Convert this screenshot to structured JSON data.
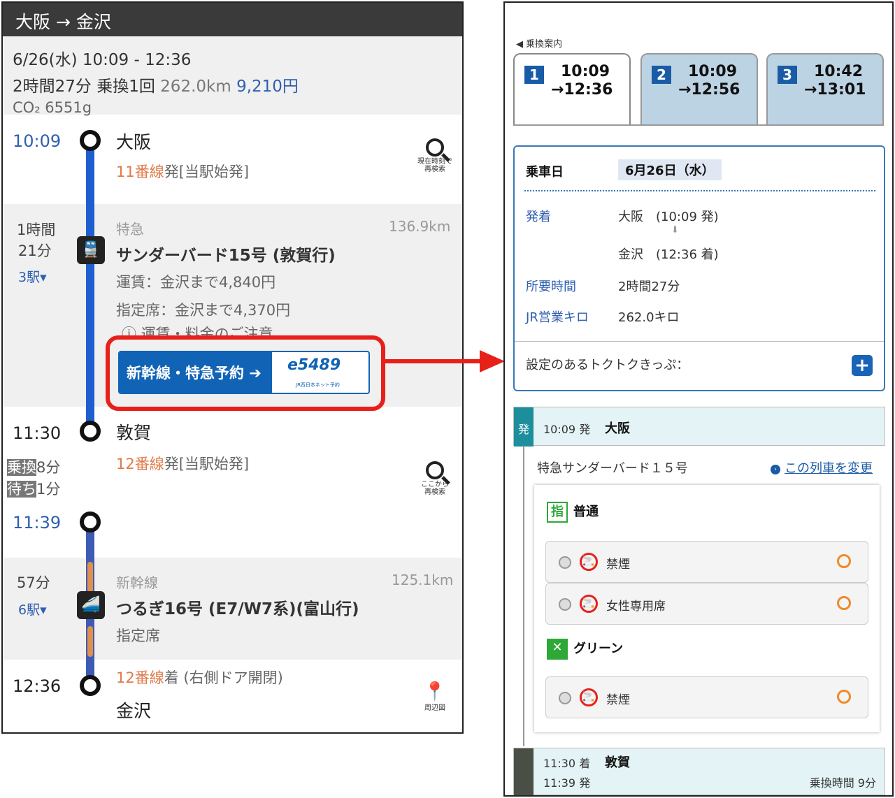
{
  "left": {
    "header": "大阪 → 金沢",
    "summary": {
      "datetime": "6/26(水) 10:09 - 12:36",
      "duration_transfers": "2時間27分 乗換1回",
      "distance": "262.0km",
      "fare": "9,210円",
      "co2": "CO₂ 6551g"
    },
    "stop1": {
      "time": "10:09",
      "station": "大阪",
      "platform_num": "11番線",
      "platform_rest": "発[当駅始発]",
      "search_label_1": "現在時刻で",
      "search_label_2": "再検索"
    },
    "leg1": {
      "duration_1": "1時間",
      "duration_2": "21分",
      "stops": "3駅▾",
      "type": "特急",
      "distance": "136.9km",
      "train": "サンダーバード15号 (敦賀行)",
      "fare": "運賃：金沢まで4,840円",
      "reserved": "指定席：金沢まで4,370円",
      "notice": "ⓘ 運賃・料金のご注意",
      "icon": "train-icon"
    },
    "booking_button": {
      "label": "新幹線・特急予約 ➔",
      "logo": "e5489",
      "logo_sub": "JR西日本ネット予約"
    },
    "stop2": {
      "time": "11:30",
      "station": "敦賀",
      "platform_num": "12番線",
      "platform_rest": "発[当駅始発]",
      "transfer_label": "乗換",
      "transfer_min": "8分",
      "wait_label": "待ち",
      "wait_min": "1分",
      "search_label_1": "ここから",
      "search_label_2": "再検索"
    },
    "stop3": {
      "time": "11:39"
    },
    "leg2": {
      "duration": "57分",
      "stops": "6駅▾",
      "type": "新幹線",
      "distance": "125.1km",
      "train": "つるぎ16号 (E7/W7系)(富山行)",
      "seat": "指定席",
      "icon": "shinkansen-icon"
    },
    "stop4": {
      "time": "12:36",
      "platform_num": "12番線",
      "platform_rest": "着 (右側ドア開閉)",
      "station": "金沢",
      "map_label": "周辺図"
    },
    "colors": {
      "line_blue": "#1e5fcf",
      "accent_orange": "#e07a4a",
      "highlight_red": "#e8201a"
    }
  },
  "right": {
    "back_link": "◀ 乗換案内",
    "tabs": [
      {
        "num": "1",
        "dep": "10:09",
        "arr": "→12:36"
      },
      {
        "num": "2",
        "dep": "10:09",
        "arr": "→12:56"
      },
      {
        "num": "3",
        "dep": "10:42",
        "arr": "→13:01"
      }
    ],
    "info": {
      "date_label": "乗車日",
      "date_value": "6月26日（水）",
      "depart_label": "発着",
      "depart_value": "大阪　(10:09 発)",
      "arrow": "⬇",
      "arrive_value": "金沢　(12:36 着)",
      "duration_label": "所要時間",
      "duration_value": "2時間27分",
      "km_label": "JR営業キロ",
      "km_value": "262.0キロ",
      "discount_label": "設定のあるトクトクきっぷ：",
      "plus": "+"
    },
    "departure": {
      "tag": "発",
      "time": "10:09 発",
      "station": "大阪"
    },
    "train_name": "特急サンダーバード１５号",
    "change_link": "この列車を変更",
    "seat_classes": [
      {
        "icon": "指",
        "label": "普通",
        "rows": [
          "禁煙",
          "女性専用席"
        ]
      },
      {
        "icon": "✕",
        "label": "グリーン",
        "rows": [
          "禁煙"
        ]
      }
    ],
    "arrival": {
      "time1": "11:30 着",
      "station": "敦賀",
      "time2": "11:39 発",
      "transfer": "乗換時間 9分"
    }
  }
}
